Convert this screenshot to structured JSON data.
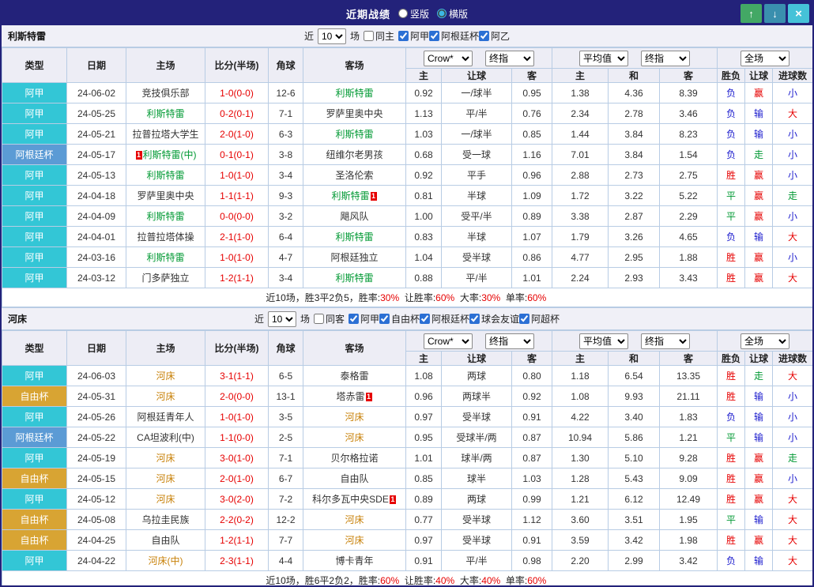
{
  "titlebar": {
    "title": "近期战绩",
    "radios": [
      {
        "label": "竖版",
        "selected": false
      },
      {
        "label": "横版",
        "selected": true
      }
    ],
    "buttons": {
      "up": "↑",
      "down": "↓",
      "close": "×"
    }
  },
  "league_colors": {
    "阿甲": "#33c6d6",
    "阿根廷杯": "#5b9bd5",
    "自由杯": "#d8a433"
  },
  "header": {
    "type": "类型",
    "date": "日期",
    "home": "主场",
    "score": "比分(半场)",
    "corner": "角球",
    "away": "客场",
    "odds_company": "Crow*",
    "odds_final": "终指",
    "avg": "平均值",
    "avg_final": "终指",
    "scope": "全场",
    "sub": [
      "主",
      "让球",
      "客",
      "主",
      "和",
      "客",
      "胜负",
      "让球",
      "进球数"
    ]
  },
  "sections": [
    {
      "team": "利斯特雷",
      "team_color": "#009933",
      "filter": {
        "near": "近",
        "count": "10",
        "games": "场",
        "same": "同主",
        "same_checked": false,
        "leagues": [
          "阿甲",
          "阿根廷杯",
          "阿乙"
        ]
      },
      "rows": [
        {
          "league": "阿甲",
          "date": "24-06-02",
          "home": {
            "name": "竞技俱乐部"
          },
          "score": "1-0(0-0)",
          "corner": "12-6",
          "away": {
            "name": "利斯特雷",
            "focus": true
          },
          "odds": [
            "0.92",
            "一/球半",
            "0.95"
          ],
          "avg": [
            "1.38",
            "4.36",
            "8.39"
          ],
          "result": "负",
          "handicap": "赢",
          "goals": "小"
        },
        {
          "league": "阿甲",
          "date": "24-05-25",
          "home": {
            "name": "利斯特雷",
            "focus": true
          },
          "score": "0-2(0-1)",
          "corner": "7-1",
          "away": {
            "name": "罗萨里奥中央"
          },
          "odds": [
            "1.13",
            "平/半",
            "0.76"
          ],
          "avg": [
            "2.34",
            "2.78",
            "3.46"
          ],
          "result": "负",
          "handicap": "输",
          "goals": "大"
        },
        {
          "league": "阿甲",
          "date": "24-05-21",
          "home": {
            "name": "拉普拉塔大学生"
          },
          "score": "2-0(1-0)",
          "corner": "6-3",
          "away": {
            "name": "利斯特雷",
            "focus": true
          },
          "odds": [
            "1.03",
            "一/球半",
            "0.85"
          ],
          "avg": [
            "1.44",
            "3.84",
            "8.23"
          ],
          "result": "负",
          "handicap": "输",
          "goals": "小"
        },
        {
          "league": "阿根廷杯",
          "date": "24-05-17",
          "home": {
            "name": "利斯特雷(中)",
            "focus": true,
            "card": "before"
          },
          "score": "0-1(0-1)",
          "corner": "3-8",
          "away": {
            "name": "纽维尔老男孩"
          },
          "odds": [
            "0.68",
            "受一球",
            "1.16"
          ],
          "avg": [
            "7.01",
            "3.84",
            "1.54"
          ],
          "result": "负",
          "handicap": "走",
          "goals": "小"
        },
        {
          "league": "阿甲",
          "date": "24-05-13",
          "home": {
            "name": "利斯特雷",
            "focus": true
          },
          "score": "1-0(1-0)",
          "corner": "3-4",
          "away": {
            "name": "圣洛伦索"
          },
          "odds": [
            "0.92",
            "平手",
            "0.96"
          ],
          "avg": [
            "2.88",
            "2.73",
            "2.75"
          ],
          "result": "胜",
          "handicap": "赢",
          "goals": "小"
        },
        {
          "league": "阿甲",
          "date": "24-04-18",
          "home": {
            "name": "罗萨里奥中央"
          },
          "score": "1-1(1-1)",
          "corner": "9-3",
          "away": {
            "name": "利斯特雷",
            "focus": true,
            "card": "after"
          },
          "odds": [
            "0.81",
            "半球",
            "1.09"
          ],
          "avg": [
            "1.72",
            "3.22",
            "5.22"
          ],
          "result": "平",
          "handicap": "赢",
          "goals": "走"
        },
        {
          "league": "阿甲",
          "date": "24-04-09",
          "home": {
            "name": "利斯特雷",
            "focus": true
          },
          "score": "0-0(0-0)",
          "corner": "3-2",
          "away": {
            "name": "飓风队"
          },
          "odds": [
            "1.00",
            "受平/半",
            "0.89"
          ],
          "avg": [
            "3.38",
            "2.87",
            "2.29"
          ],
          "result": "平",
          "handicap": "赢",
          "goals": "小"
        },
        {
          "league": "阿甲",
          "date": "24-04-01",
          "home": {
            "name": "拉普拉塔体操"
          },
          "score": "2-1(1-0)",
          "corner": "6-4",
          "away": {
            "name": "利斯特雷",
            "focus": true
          },
          "odds": [
            "0.83",
            "半球",
            "1.07"
          ],
          "avg": [
            "1.79",
            "3.26",
            "4.65"
          ],
          "result": "负",
          "handicap": "输",
          "goals": "大"
        },
        {
          "league": "阿甲",
          "date": "24-03-16",
          "home": {
            "name": "利斯特雷",
            "focus": true
          },
          "score": "1-0(1-0)",
          "corner": "4-7",
          "away": {
            "name": "阿根廷独立"
          },
          "odds": [
            "1.04",
            "受半球",
            "0.86"
          ],
          "avg": [
            "4.77",
            "2.95",
            "1.88"
          ],
          "result": "胜",
          "handicap": "赢",
          "goals": "小"
        },
        {
          "league": "阿甲",
          "date": "24-03-12",
          "home": {
            "name": "门多萨独立"
          },
          "score": "1-2(1-1)",
          "corner": "3-4",
          "away": {
            "name": "利斯特雷",
            "focus": true
          },
          "odds": [
            "0.88",
            "平/半",
            "1.01"
          ],
          "avg": [
            "2.24",
            "2.93",
            "3.43"
          ],
          "result": "胜",
          "handicap": "赢",
          "goals": "大"
        }
      ],
      "summary": {
        "prefix": "近10场，胜3平2负5，",
        "stats": [
          {
            "label": "胜率:",
            "value": "30%"
          },
          {
            "label": "让胜率:",
            "value": "60%"
          },
          {
            "label": "大率:",
            "value": "30%"
          },
          {
            "label": "单率:",
            "value": "60%"
          }
        ]
      }
    },
    {
      "team": "河床",
      "team_color": "#c8820a",
      "filter": {
        "near": "近",
        "count": "10",
        "games": "场",
        "same": "同客",
        "same_checked": false,
        "leagues": [
          "阿甲",
          "自由杯",
          "阿根廷杯",
          "球会友谊",
          "阿超杯"
        ]
      },
      "rows": [
        {
          "league": "阿甲",
          "date": "24-06-03",
          "home": {
            "name": "河床",
            "focus": true
          },
          "score": "3-1(1-1)",
          "corner": "6-5",
          "away": {
            "name": "泰格雷"
          },
          "odds": [
            "1.08",
            "两球",
            "0.80"
          ],
          "avg": [
            "1.18",
            "6.54",
            "13.35"
          ],
          "result": "胜",
          "handicap": "走",
          "goals": "大"
        },
        {
          "league": "自由杯",
          "date": "24-05-31",
          "home": {
            "name": "河床",
            "focus": true
          },
          "score": "2-0(0-0)",
          "corner": "13-1",
          "away": {
            "name": "塔赤雷",
            "card": "after"
          },
          "odds": [
            "0.96",
            "两球半",
            "0.92"
          ],
          "avg": [
            "1.08",
            "9.93",
            "21.11"
          ],
          "result": "胜",
          "handicap": "输",
          "goals": "小"
        },
        {
          "league": "阿甲",
          "date": "24-05-26",
          "home": {
            "name": "阿根廷青年人"
          },
          "score": "1-0(1-0)",
          "corner": "3-5",
          "away": {
            "name": "河床",
            "focus": true
          },
          "odds": [
            "0.97",
            "受半球",
            "0.91"
          ],
          "avg": [
            "4.22",
            "3.40",
            "1.83"
          ],
          "result": "负",
          "handicap": "输",
          "goals": "小"
        },
        {
          "league": "阿根廷杯",
          "date": "24-05-22",
          "home": {
            "name": "CA坦波利(中)"
          },
          "score": "1-1(0-0)",
          "corner": "2-5",
          "away": {
            "name": "河床",
            "focus": true
          },
          "odds": [
            "0.95",
            "受球半/两",
            "0.87"
          ],
          "avg": [
            "10.94",
            "5.86",
            "1.21"
          ],
          "result": "平",
          "handicap": "输",
          "goals": "小"
        },
        {
          "league": "阿甲",
          "date": "24-05-19",
          "home": {
            "name": "河床",
            "focus": true
          },
          "score": "3-0(1-0)",
          "corner": "7-1",
          "away": {
            "name": "贝尔格拉诺"
          },
          "odds": [
            "1.01",
            "球半/两",
            "0.87"
          ],
          "avg": [
            "1.30",
            "5.10",
            "9.28"
          ],
          "result": "胜",
          "handicap": "赢",
          "goals": "走"
        },
        {
          "league": "自由杯",
          "date": "24-05-15",
          "home": {
            "name": "河床",
            "focus": true
          },
          "score": "2-0(1-0)",
          "corner": "6-7",
          "away": {
            "name": "自由队"
          },
          "odds": [
            "0.85",
            "球半",
            "1.03"
          ],
          "avg": [
            "1.28",
            "5.43",
            "9.09"
          ],
          "result": "胜",
          "handicap": "赢",
          "goals": "小"
        },
        {
          "league": "阿甲",
          "date": "24-05-12",
          "home": {
            "name": "河床",
            "focus": true
          },
          "score": "3-0(2-0)",
          "corner": "7-2",
          "away": {
            "name": "科尔多瓦中央SDE",
            "card": "after"
          },
          "odds": [
            "0.89",
            "两球",
            "0.99"
          ],
          "avg": [
            "1.21",
            "6.12",
            "12.49"
          ],
          "result": "胜",
          "handicap": "赢",
          "goals": "大"
        },
        {
          "league": "自由杯",
          "date": "24-05-08",
          "home": {
            "name": "乌拉圭民族"
          },
          "score": "2-2(0-2)",
          "corner": "12-2",
          "away": {
            "name": "河床",
            "focus": true
          },
          "odds": [
            "0.77",
            "受半球",
            "1.12"
          ],
          "avg": [
            "3.60",
            "3.51",
            "1.95"
          ],
          "result": "平",
          "handicap": "输",
          "goals": "大"
        },
        {
          "league": "自由杯",
          "date": "24-04-25",
          "home": {
            "name": "自由队"
          },
          "score": "1-2(1-1)",
          "corner": "7-7",
          "away": {
            "name": "河床",
            "focus": true
          },
          "odds": [
            "0.97",
            "受半球",
            "0.91"
          ],
          "avg": [
            "3.59",
            "3.42",
            "1.98"
          ],
          "result": "胜",
          "handicap": "赢",
          "goals": "大"
        },
        {
          "league": "阿甲",
          "date": "24-04-22",
          "home": {
            "name": "河床(中)",
            "focus": true
          },
          "score": "2-3(1-1)",
          "corner": "4-4",
          "away": {
            "name": "博卡青年"
          },
          "odds": [
            "0.91",
            "平/半",
            "0.98"
          ],
          "avg": [
            "2.20",
            "2.99",
            "3.42"
          ],
          "result": "负",
          "handicap": "输",
          "goals": "大"
        }
      ],
      "summary": {
        "prefix": "近10场，胜6平2负2，",
        "stats": [
          {
            "label": "胜率:",
            "value": "60%"
          },
          {
            "label": "让胜率:",
            "value": "40%"
          },
          {
            "label": "大率:",
            "value": "40%"
          },
          {
            "label": "单率:",
            "value": "60%"
          }
        ]
      }
    }
  ]
}
